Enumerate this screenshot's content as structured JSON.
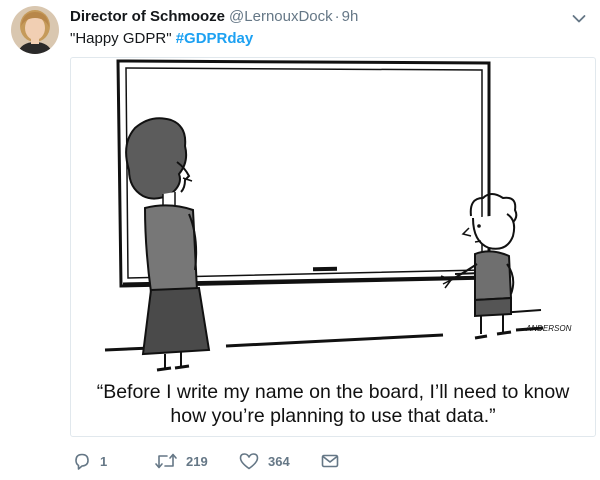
{
  "author": {
    "display_name": "Director of Schmooze",
    "handle": "@LernouxDock",
    "separator": "·",
    "time": "9h"
  },
  "tweet": {
    "text": "\"Happy GDPR\"",
    "hashtag": "#GDPRday"
  },
  "media": {
    "caption_line_1": "“Before I write my name on the board, I’ll need to know",
    "caption_line_2": "how you’re planning to use that data.”",
    "signature": "ANDERSON"
  },
  "actions": {
    "reply_count": "1",
    "retweet_count": "219",
    "like_count": "364"
  },
  "icons": {
    "reply": "reply-icon",
    "retweet": "retweet-icon",
    "like": "heart-icon",
    "dm": "envelope-icon",
    "menu": "chevron-down-icon"
  },
  "colors": {
    "hashtag": "#1da1f2",
    "secondary_text": "#657786",
    "primary_text": "#14171a",
    "border": "#e1e8ed"
  }
}
